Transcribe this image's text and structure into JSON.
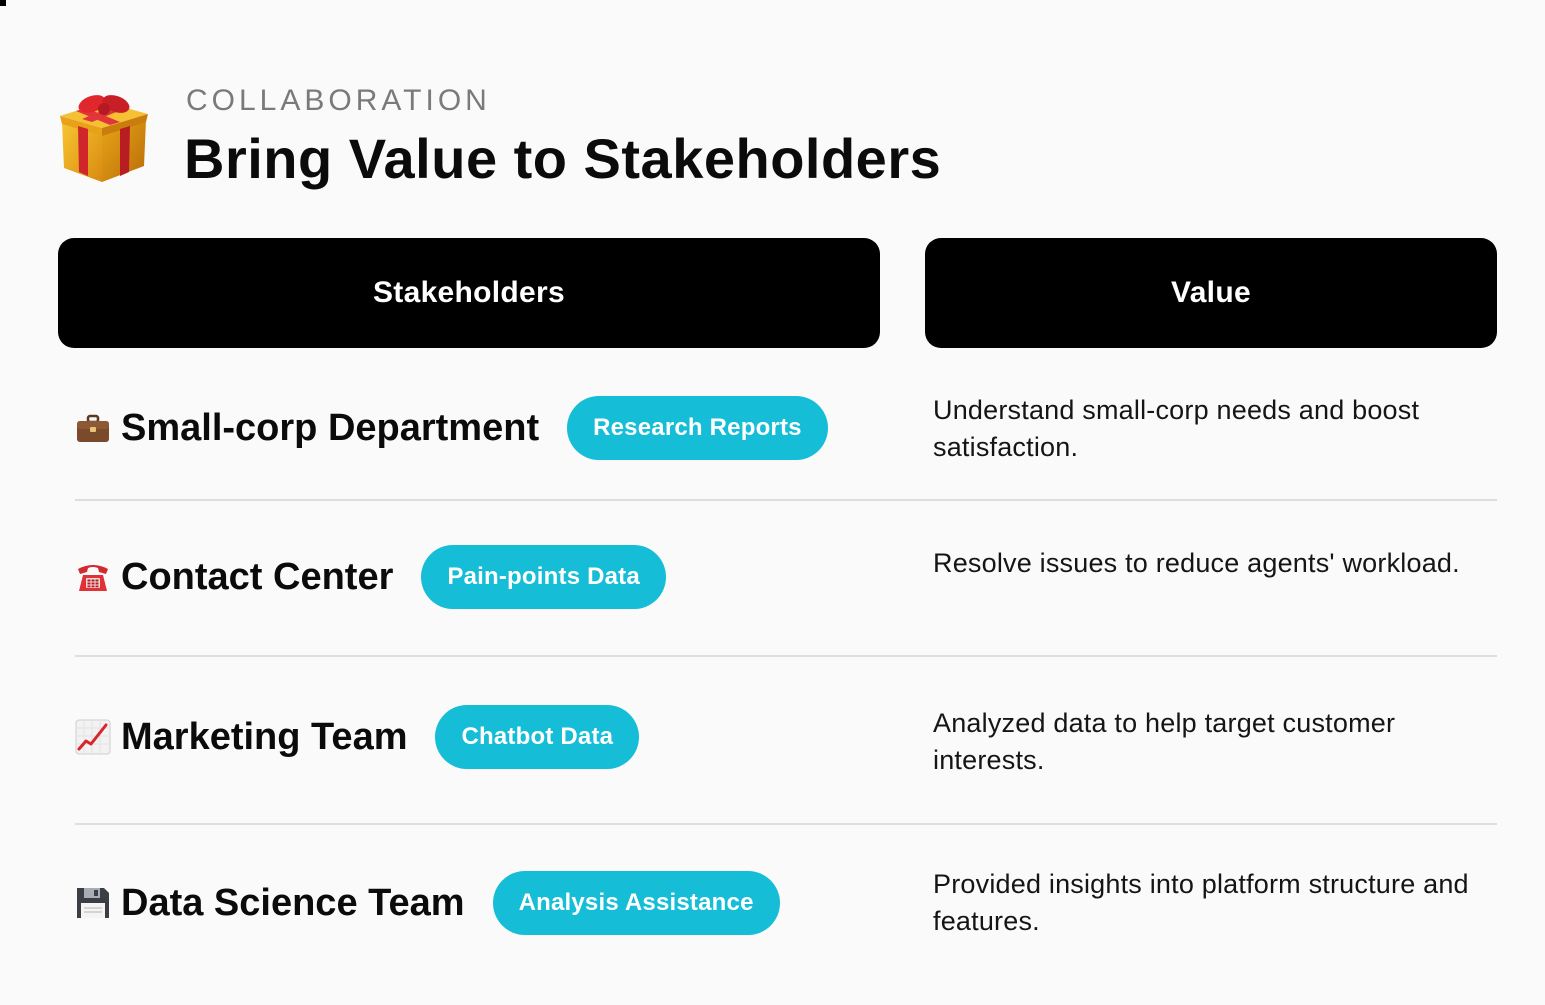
{
  "header": {
    "eyebrow": "COLLABORATION",
    "title": "Bring Value to Stakeholders",
    "icon": "gift-icon"
  },
  "columns": {
    "stakeholders_label": "Stakeholders",
    "value_label": "Value"
  },
  "rows": [
    {
      "icon": "briefcase-icon",
      "name": "Small-corp Department",
      "tag": "Research Reports",
      "value": "Understand small-corp needs and boost satisfaction."
    },
    {
      "icon": "telephone-icon",
      "name": "Contact Center",
      "tag": "Pain-points Data",
      "value": "Resolve issues to reduce agents' workload."
    },
    {
      "icon": "chart-increasing-icon",
      "name": "Marketing Team",
      "tag": "Chatbot Data",
      "value": "Analyzed data to help target customer interests."
    },
    {
      "icon": "floppy-disk-icon",
      "name": "Data Science Team",
      "tag": "Analysis Assistance",
      "value": "Provided insights into platform structure and features."
    }
  ],
  "colors": {
    "background": "#fafafa",
    "header_bg": "#000000",
    "pill_bg": "#15bdd6",
    "divider": "#dedede"
  }
}
